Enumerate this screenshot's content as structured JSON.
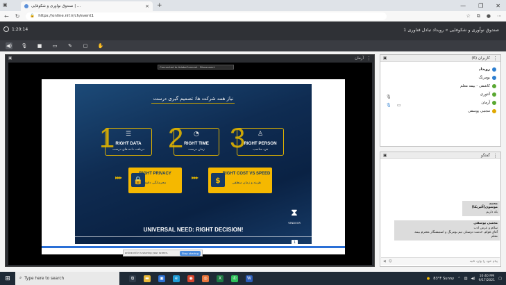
{
  "browser": {
    "tab_title": "صندوق نوآوری و شکوفایی | ...",
    "url": "https://online.nif.ir/ch/event1",
    "window_controls": [
      "—",
      "❐",
      "✕"
    ]
  },
  "app": {
    "timer": "1:20:14",
    "room_title": "صندوق نوآوری و شکوفایی » رویداد تبادل فناوری 1"
  },
  "video_panel": {
    "label": "آرمان",
    "share_notice": "Connected to AdobeConnect · Disconnect",
    "stop_bar_text": "online.nif.ir is sharing your screen.",
    "stop_button": "Stop sharing"
  },
  "slide": {
    "title": "نیاز همه شرکت ها: تصمیم گیری درست",
    "items": [
      {
        "num": "1",
        "title": "RIGHT DATA",
        "sub": "دریافت داده های درست"
      },
      {
        "num": "2",
        "title": "RIGHT TIME",
        "sub": "زمان درست"
      },
      {
        "num": "3",
        "title": "RIGHT PERSON",
        "sub": "فرد مناسب"
      }
    ],
    "privacy": {
      "title": "RIGHT PRIVACY",
      "sub": "محرمانگی دقیق"
    },
    "cost": {
      "title": "RIGHT COST VS SPEED",
      "sub": "هزینه و زمان منطقی"
    },
    "footer": "UNIVERSAL NEED: RIGHT DECISION!",
    "logo_text": "VENDOOR",
    "page_number": "1"
  },
  "users_panel": {
    "label": "کاربران (6)",
    "users": [
      {
        "name": "رویداد",
        "color": "#2d7fd0",
        "host": true
      },
      {
        "name": "بومرنگ",
        "color": "#2d7fd0",
        "host": false
      },
      {
        "name": "کاشفی - بیمه معلم",
        "color": "#5aa832",
        "host": false
      },
      {
        "name": "آنتوری",
        "color": "#5aa832",
        "host": false
      },
      {
        "name": "آرمان",
        "color": "#5aa832",
        "host": false
      },
      {
        "name": "مجتبی یوسفی",
        "color": "#e0a800",
        "host": false
      }
    ]
  },
  "chat_panel": {
    "label": "گفتگو",
    "messages": [
      {
        "sender": "محمد موسوی(آلیریکا)",
        "lines": [
          "بله داریم"
        ]
      },
      {
        "sender": "مجتبی یوسفی",
        "lines": [
          "سلام و عرض ادب",
          "آقای قوام، خدمت دوستان تیم بومرنگ و استیشنگار محترم بیمه",
          "معلم"
        ]
      }
    ],
    "input_placeholder": "پیام خود را وارد کنید"
  },
  "taskbar": {
    "search_placeholder": "Type here to search",
    "weather": "83°F Sunny",
    "time": "10:40 PM",
    "date": "9/17/2021",
    "apps": [
      {
        "icon": "task-view-icon",
        "color": "#2f3b49"
      },
      {
        "icon": "folder-icon",
        "color": "#e8b838"
      },
      {
        "icon": "store-icon",
        "color": "#2c6fd1"
      },
      {
        "icon": "edge-icon",
        "color": "#1e9bd6"
      },
      {
        "icon": "chrome-icon",
        "color": "#d9452e"
      },
      {
        "icon": "firefox-icon",
        "color": "#e8743a"
      },
      {
        "icon": "excel-icon",
        "color": "#1e7a43"
      },
      {
        "icon": "whatsapp-icon",
        "color": "#2ec05a"
      },
      {
        "icon": "word-icon",
        "color": "#2b5cb8"
      }
    ]
  }
}
